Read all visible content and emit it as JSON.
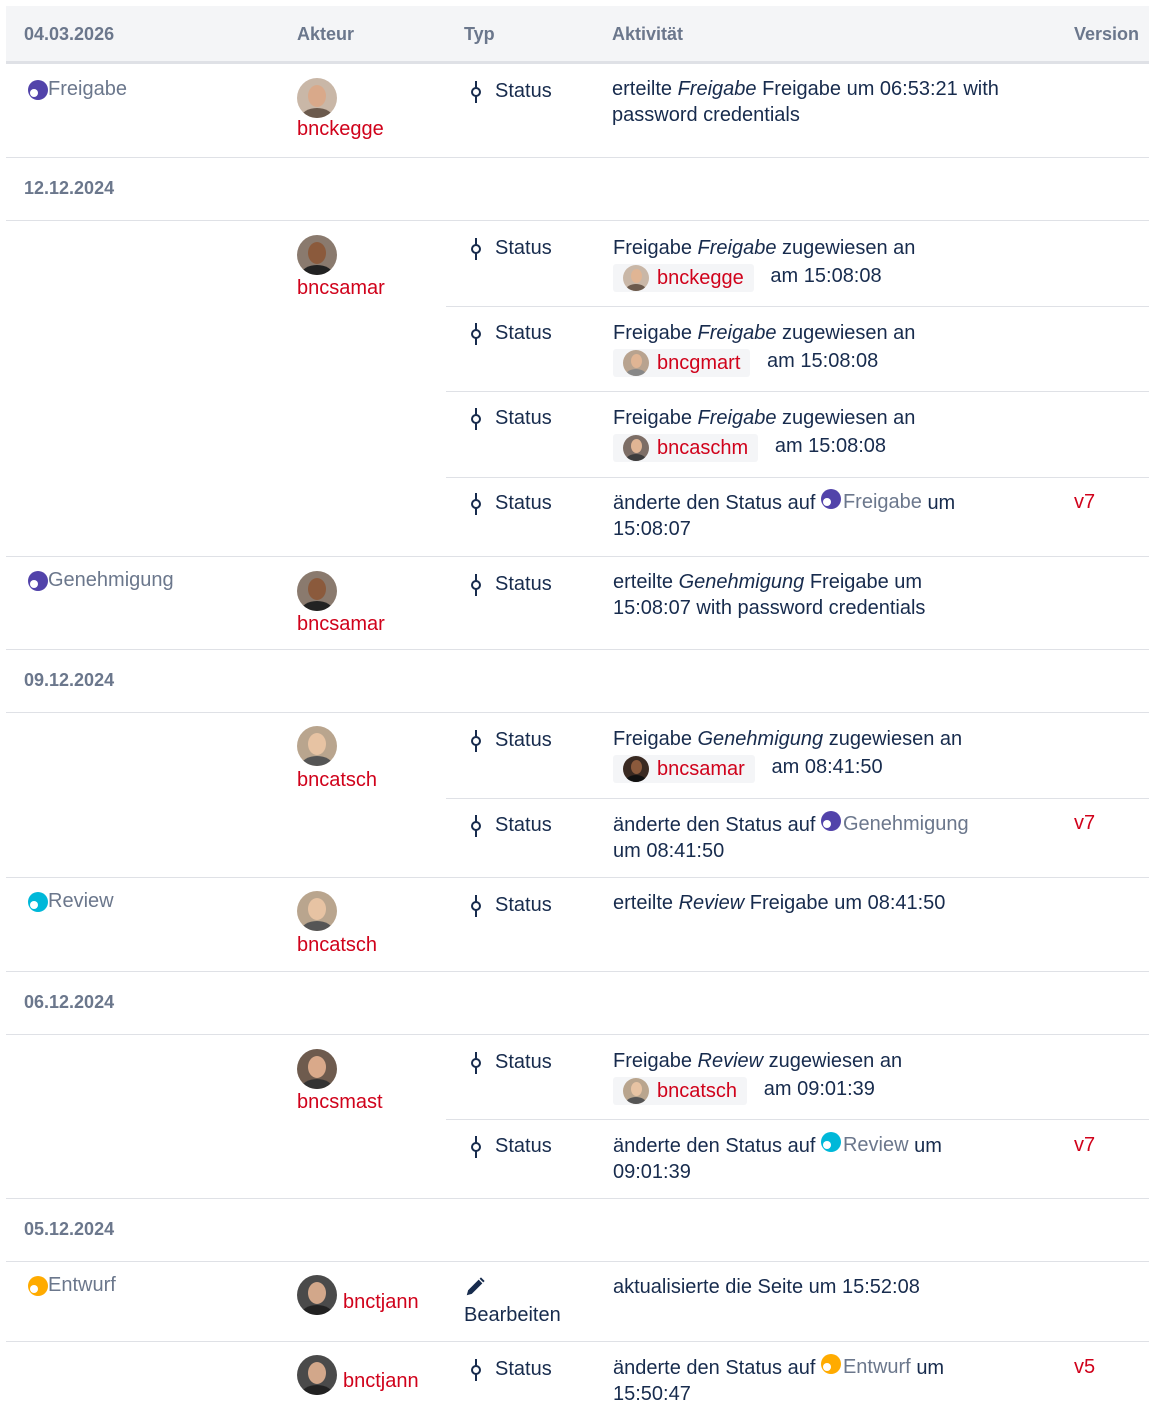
{
  "header": {
    "date": "04.03.2026",
    "akteur": "Akteur",
    "typ": "Typ",
    "aktivitaet": "Aktivität",
    "version": "Version"
  },
  "colors": {
    "link": "#d0021b",
    "purple": "#5243aa",
    "blue": "#00b8d9",
    "yellow": "#ffab00"
  },
  "common": {
    "status": "Status",
    "bearbeiten": "Bearbeiten",
    "assigned_prefix": "Freigabe",
    "assigned_mid": "zugewiesen an",
    "changed_status": "änderte den Status auf",
    "um": "um",
    "am": "am",
    "erteilte": "erteilte",
    "freigabe_um": "Freigabe um"
  },
  "block1": {
    "stage": "Freigabe",
    "user": "bnckegge",
    "activity_stage": "Freigabe",
    "activity_rest": "Freigabe um 06:53:21 with password credentials"
  },
  "date2": "12.12.2024",
  "block2": {
    "user": "bncsamar",
    "entries": [
      {
        "stage": "Freigabe",
        "mention": "bnckegge",
        "time": "am 15:08:08"
      },
      {
        "stage": "Freigabe",
        "mention": "bncgmart",
        "time": "am 15:08:08"
      },
      {
        "stage": "Freigabe",
        "mention": "bncaschm",
        "time": "am 15:08:08"
      }
    ],
    "change": {
      "stage": "Freigabe",
      "time": "15:08:07",
      "version": "v7"
    }
  },
  "block3": {
    "stage": "Genehmigung",
    "user": "bncsamar",
    "activity_stage": "Genehmigung",
    "activity_rest": "Freigabe um 15:08:07 with password credentials"
  },
  "date3": "09.12.2024",
  "block4": {
    "user": "bncatsch",
    "entry": {
      "stage": "Genehmigung",
      "mention": "bncsamar",
      "time": "am 08:41:50"
    },
    "change": {
      "stage": "Genehmigung",
      "time": "um 08:41:50",
      "version": "v7"
    }
  },
  "block5": {
    "stage": "Review",
    "user": "bncatsch",
    "activity_stage": "Review",
    "activity_rest": "Freigabe um 08:41:50"
  },
  "date4": "06.12.2024",
  "block6": {
    "user": "bncsmast",
    "entry": {
      "stage": "Review",
      "mention": "bncatsch",
      "time": "am 09:01:39"
    },
    "change": {
      "stage": "Review",
      "time": "09:01:39",
      "version": "v7"
    }
  },
  "date5": "05.12.2024",
  "block7": {
    "stage": "Entwurf",
    "user": "bnctjann",
    "activity": "aktualisierte die Seite um 15:52:08"
  },
  "block8": {
    "user": "bnctjann",
    "change": {
      "stage": "Entwurf",
      "time": "15:50:47",
      "version": "v5"
    }
  }
}
